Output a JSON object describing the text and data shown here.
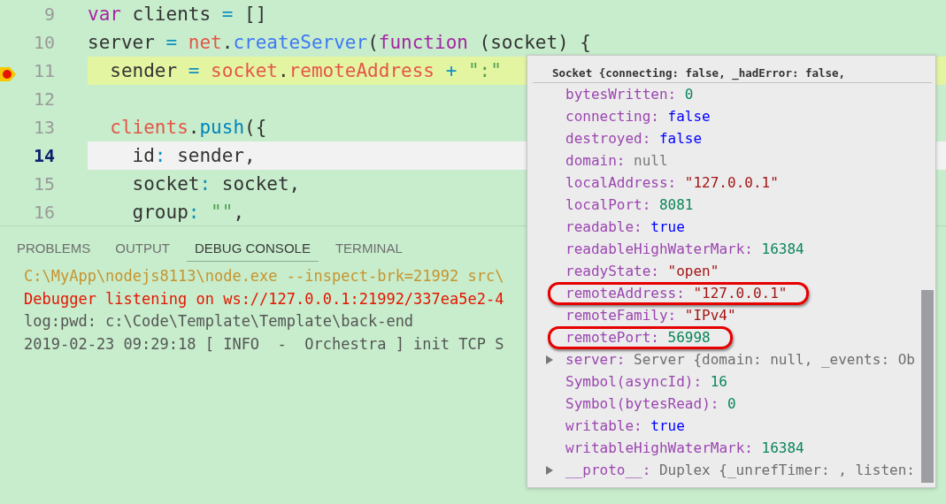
{
  "editor": {
    "lines": [
      {
        "number": "9",
        "current": false,
        "breakpoint": false,
        "tokens": [
          {
            "text": "var",
            "kind": "keyword"
          },
          {
            "text": " clients ",
            "kind": "plain"
          },
          {
            "text": "=",
            "kind": "operator"
          },
          {
            "text": " []",
            "kind": "plain"
          }
        ]
      },
      {
        "number": "10",
        "current": false,
        "breakpoint": false,
        "tokens": [
          {
            "text": "server ",
            "kind": "plain"
          },
          {
            "text": "= ",
            "kind": "operator"
          },
          {
            "text": "net",
            "kind": "variable"
          },
          {
            "text": ".",
            "kind": "plain"
          },
          {
            "text": "createServer",
            "kind": "function"
          },
          {
            "text": "(",
            "kind": "plain"
          },
          {
            "text": "function",
            "kind": "keyword"
          },
          {
            "text": " (socket) {",
            "kind": "plain"
          }
        ]
      },
      {
        "number": "11",
        "current": false,
        "breakpoint": true,
        "tokens": [
          {
            "text": "  sender ",
            "kind": "plain"
          },
          {
            "text": "= ",
            "kind": "operator"
          },
          {
            "text": "socket",
            "kind": "variable"
          },
          {
            "text": ".",
            "kind": "plain"
          },
          {
            "text": "remoteAddress ",
            "kind": "variable"
          },
          {
            "text": "+",
            "kind": "operator"
          },
          {
            "text": " \":\"",
            "kind": "string"
          }
        ]
      },
      {
        "number": "12",
        "current": false,
        "breakpoint": false
      },
      {
        "number": "13",
        "current": false,
        "breakpoint": false,
        "tokens": [
          {
            "text": "  clients",
            "kind": "variable"
          },
          {
            "text": ".",
            "kind": "plain"
          },
          {
            "text": "push",
            "kind": "method"
          },
          {
            "text": "({",
            "kind": "plain"
          }
        ]
      },
      {
        "number": "14",
        "current": true,
        "breakpoint": false,
        "tokens": [
          {
            "text": "    id",
            "kind": "plain"
          },
          {
            "text": ":",
            "kind": "operator"
          },
          {
            "text": " sender,",
            "kind": "plain"
          }
        ]
      },
      {
        "number": "15",
        "current": false,
        "breakpoint": false,
        "tokens": [
          {
            "text": "    socket",
            "kind": "plain"
          },
          {
            "text": ":",
            "kind": "operator"
          },
          {
            "text": " socket,",
            "kind": "plain"
          }
        ]
      },
      {
        "number": "16",
        "current": false,
        "breakpoint": false,
        "tokens": [
          {
            "text": "    group",
            "kind": "plain"
          },
          {
            "text": ": ",
            "kind": "operator"
          },
          {
            "text": "\"\"",
            "kind": "string"
          },
          {
            "text": ",",
            "kind": "plain"
          }
        ]
      }
    ]
  },
  "panel": {
    "tabs": [
      {
        "label": "PROBLEMS",
        "selected": false
      },
      {
        "label": "OUTPUT",
        "selected": false
      },
      {
        "label": "DEBUG CONSOLE",
        "selected": true
      },
      {
        "label": "TERMINAL",
        "selected": false
      }
    ],
    "console": [
      {
        "kind": "command",
        "text": "C:\\MyApp\\nodejs8113\\node.exe --inspect-brk=21992 src\\"
      },
      {
        "kind": "error",
        "text": "Debugger listening on ws://127.0.0.1:21992/337ea5e2-4"
      },
      {
        "kind": "log",
        "text": "log:pwd: c:\\Code\\Template\\Template\\back-end"
      },
      {
        "kind": "log",
        "text": "2019-02-23 09:29:18 [ INFO  -  Orchestra ] init TCP S"
      }
    ]
  },
  "hover": {
    "title": "Socket {connecting: false, _hadError: false,",
    "properties": [
      {
        "name": "bytesWritten:",
        "value": "0",
        "kind": "number",
        "circled": false
      },
      {
        "name": "connecting:",
        "value": "false",
        "kind": "boolean",
        "circled": false
      },
      {
        "name": "destroyed:",
        "value": "false",
        "kind": "boolean",
        "circled": false
      },
      {
        "name": "domain:",
        "value": "null",
        "kind": "null",
        "circled": false
      },
      {
        "name": "localAddress:",
        "value": "\"127.0.0.1\"",
        "kind": "string",
        "circled": false
      },
      {
        "name": "localPort:",
        "value": "8081",
        "kind": "number",
        "circled": false
      },
      {
        "name": "readable:",
        "value": "true",
        "kind": "boolean",
        "circled": false
      },
      {
        "name": "readableHighWaterMark:",
        "value": "16384",
        "kind": "number",
        "circled": false
      },
      {
        "name": "readyState:",
        "value": "\"open\"",
        "kind": "string",
        "circled": false
      },
      {
        "name": "remoteAddress:",
        "value": "\"127.0.0.1\"",
        "kind": "string",
        "circled": true
      },
      {
        "name": "remoteFamily:",
        "value": "\"IPv4\"",
        "kind": "string",
        "circled": false
      },
      {
        "name": "remotePort:",
        "value": "56998",
        "kind": "number",
        "circled": true
      },
      {
        "name": "server:",
        "value": "Server {domain: null, _events: Ob",
        "kind": "object",
        "expanded": false,
        "circled": false
      },
      {
        "name": "Symbol(asyncId):",
        "value": "16",
        "kind": "number",
        "circled": false
      },
      {
        "name": "Symbol(bytesRead):",
        "value": "0",
        "kind": "number",
        "circled": false
      },
      {
        "name": "writable:",
        "value": "true",
        "kind": "boolean",
        "circled": false
      },
      {
        "name": "writableHighWaterMark:",
        "value": "16384",
        "kind": "number",
        "circled": false
      },
      {
        "name": "__proto__:",
        "value": "Duplex {_unrefTimer: , listen:",
        "kind": "object",
        "expanded": false,
        "circled": false
      }
    ]
  }
}
